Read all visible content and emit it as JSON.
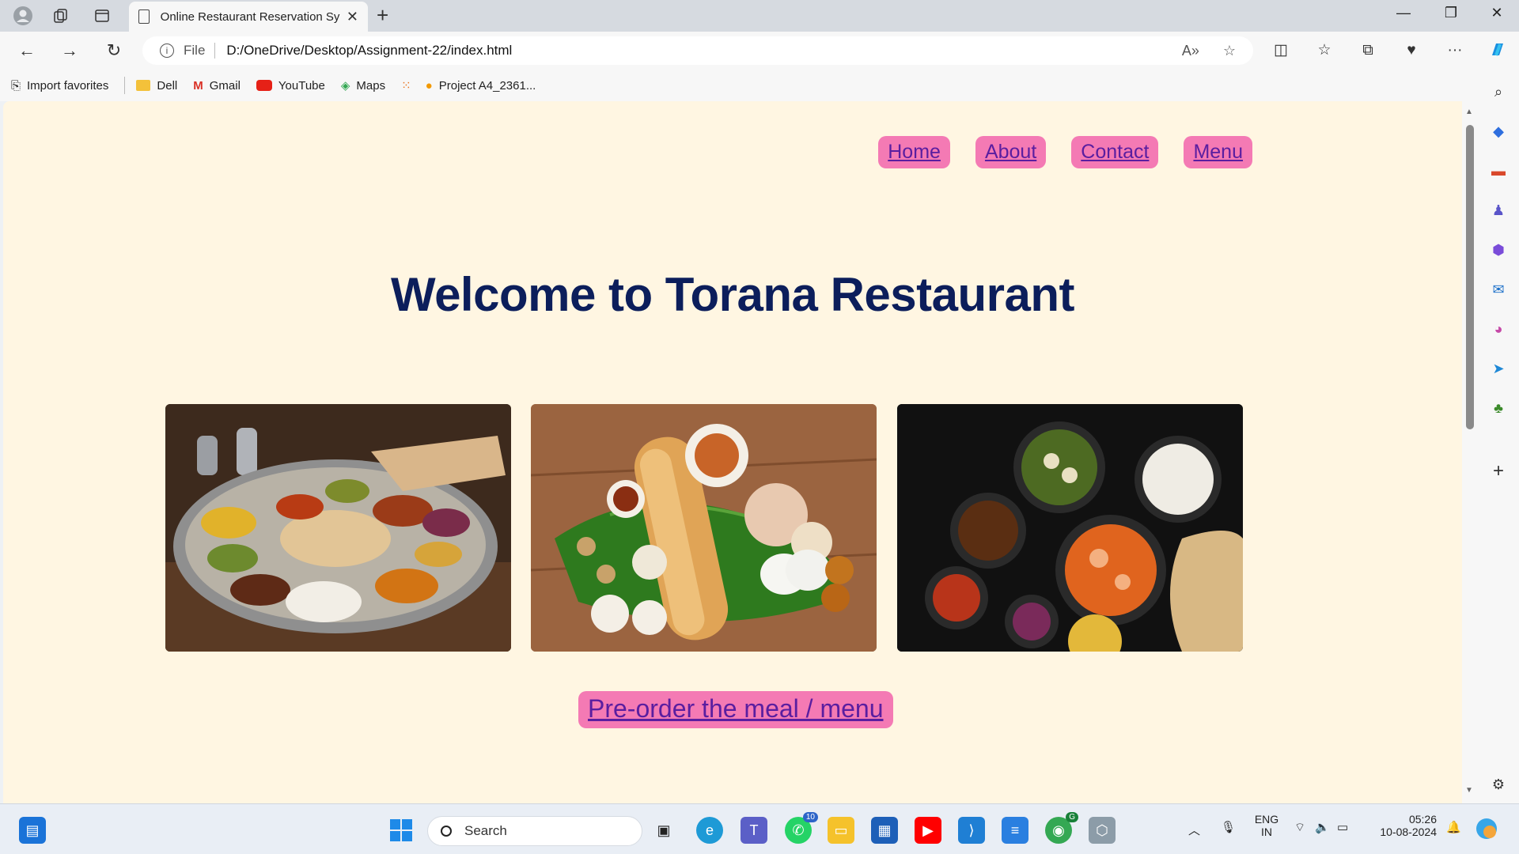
{
  "browser": {
    "tab_title": "Online Restaurant Reservation Sy",
    "address_prefix": "File",
    "url": "D:/OneDrive/Desktop/Assignment-22/index.html"
  },
  "favorites": [
    {
      "label": "Import favorites",
      "icon": "import-icon"
    },
    {
      "label": "Dell",
      "icon": "folder-icon"
    },
    {
      "label": "Gmail",
      "icon": "gmail-icon"
    },
    {
      "label": "YouTube",
      "icon": "youtube-icon"
    },
    {
      "label": "Maps",
      "icon": "maps-icon"
    },
    {
      "label": "",
      "icon": "apps-icon"
    },
    {
      "label": "Project A4_2361...",
      "icon": "flame-icon"
    }
  ],
  "page": {
    "nav": [
      "Home",
      "About",
      "Contact",
      "Menu"
    ],
    "heading": "Welcome to Torana Restaurant",
    "cta": "Pre-order the meal / menu",
    "accent_color": "#f47ab4",
    "heading_color": "#0c1e5b",
    "background_color": "#fff6e2"
  },
  "taskbar": {
    "search_placeholder": "Search",
    "whatsapp_badge": "10",
    "chrome_badge": "G",
    "language_line1": "ENG",
    "language_line2": "IN",
    "time": "05:26",
    "date": "10-08-2024"
  }
}
